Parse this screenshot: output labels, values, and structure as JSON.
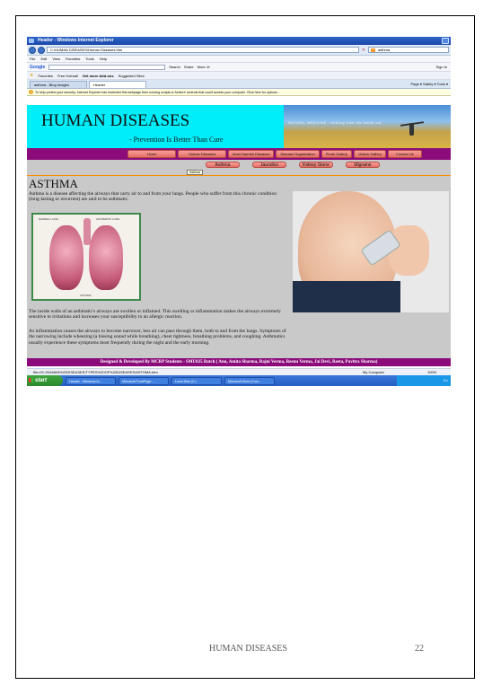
{
  "browser": {
    "window_title": "Header - Windows Internet Explorer",
    "address": "C:\\HUMAN DISEASES\\Human Diseases.htm",
    "search_query": "asthma",
    "menu": [
      "File",
      "Edit",
      "View",
      "Favorites",
      "Tools",
      "Help"
    ],
    "google_bar": {
      "logo": "Google",
      "search": "Search",
      "share": "Share",
      "more": "More ≫",
      "sign_in": "Sign In"
    },
    "favorites": {
      "label": "Favorites",
      "items": [
        "Free Hotmail",
        "Get more Add-ons",
        "Suggested Sites"
      ]
    },
    "tabs": [
      "asthma - Bing Images",
      "Header"
    ],
    "tab_tools": "Page ▾  Safety ▾  Tools ▾",
    "infobar": "To help protect your security, Internet Explorer has restricted this webpage from running scripts or ActiveX controls that could access your computer. Click here for options...",
    "status_url": "file:///C:/HUMAN%20DISEASES/TYPES%20OF%20DISEASES/ASTHMA.htm",
    "status_zone": "My Computer",
    "status_zoom": "100%"
  },
  "site": {
    "title": "HUMAN DISEASES",
    "subtitle": "- Prevention Is Better Than Cure",
    "banner_tagline": "NATURAL MEDICINE · Healing from the inside out",
    "menu": [
      "Home",
      "Human Diseases",
      "Most Harmful Diseases",
      "Disease Organization",
      "Photo Gallery",
      "Videos Gallery",
      "Contact Us"
    ],
    "submenu": [
      "Asthma",
      "Jaundice",
      "Kidney Stone",
      "Migraine"
    ],
    "tooltip": "Asthma",
    "heading": "ASTHMA",
    "para1": "Asthma is a disease affecting the airways that carry air to and from your lungs. People who suffer from this chronic condition (long-lasting or recurrent) are said to be asthmatic.",
    "lung_labels": {
      "normal": "NORMAL LUNG",
      "asthmatic": "ASTHMATIC LUNG",
      "caption": "ASTHMA"
    },
    "para2": "The inside walls of an asthmatic's airways are swollen or inflamed. This swelling or inflammation makes the airways extremely sensitive to irritations and increases your susceptibility to an allergic reaction.",
    "para3": "As inflammation causes the airways to become narrower, less air can pass through them, both to and from the lungs. Symptoms of the narrowing include wheezing (a hissing sound while breathing), chest tightness, breathing problems, and coughing. Asthmatics usually experience these symptoms most frequently during the night and the early morning.",
    "footer": "Designed & Developed By MCRP Students - SMU025 Batch ( Anu, Amita Sharma, Rajni Verma, Reenu Verma, Jai Devi, Reeta, Pavitra Sharma)"
  },
  "taskbar": {
    "start": "start",
    "items": [
      "Header - Windows In...",
      "Microsoft FrontPage -...",
      "Local Disk (C:)",
      "Microsoft Word (Com..."
    ],
    "clock": "5:1"
  },
  "document": {
    "footer_title": "HUMAN DISEASES",
    "page_number": "22"
  },
  "colors": {
    "banner": "#00eefa",
    "menu_bar": "#8b0b7a",
    "button": "#e46d64",
    "content_bg": "#c9c9c9"
  }
}
